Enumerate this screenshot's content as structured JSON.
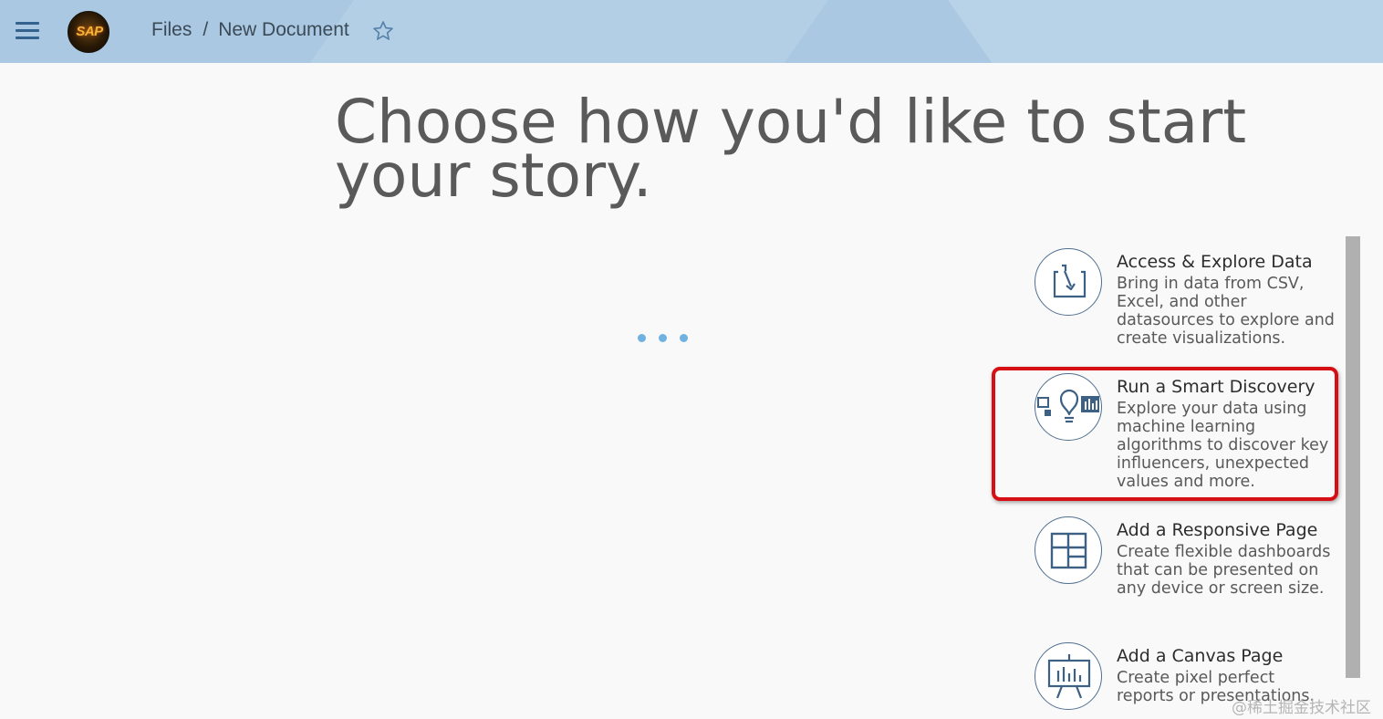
{
  "header": {
    "logo_text": "SAP",
    "breadcrumb": {
      "root": "Files",
      "separator": "/",
      "current": "New Document"
    },
    "menu_icon": "hamburger-menu-icon",
    "favorite_icon": "star-outline-icon"
  },
  "main": {
    "heading": "Choose how you'd like to start your story.",
    "loading_indicator": "busy-dots"
  },
  "options": [
    {
      "title": "Access & Explore Data",
      "description": "Bring in data from CSV, Excel, and other datasources to explore and create visualizations.",
      "icon": "import-data-icon"
    },
    {
      "title": "Run a Smart Discovery",
      "description": "Explore your data using machine learning algorithms to discover key influencers, unexpected values and more.",
      "icon": "smart-discovery-icon",
      "highlighted": true
    },
    {
      "title": "Add a Responsive Page",
      "description": "Create flexible dashboards that can be presented on any device or screen size.",
      "icon": "responsive-layout-icon"
    },
    {
      "title": "Add a Canvas Page",
      "description": "Create pixel perfect reports or presentations.",
      "icon": "presentation-easel-icon"
    }
  ],
  "watermark": "@稀土掘金技术社区",
  "colors": {
    "header_bg": "#aac8e2",
    "page_bg": "#f9f9fa",
    "icon_stroke": "#4f6f8f",
    "highlight_border": "#d50f14",
    "loader_dot": "#6fb2e2"
  }
}
